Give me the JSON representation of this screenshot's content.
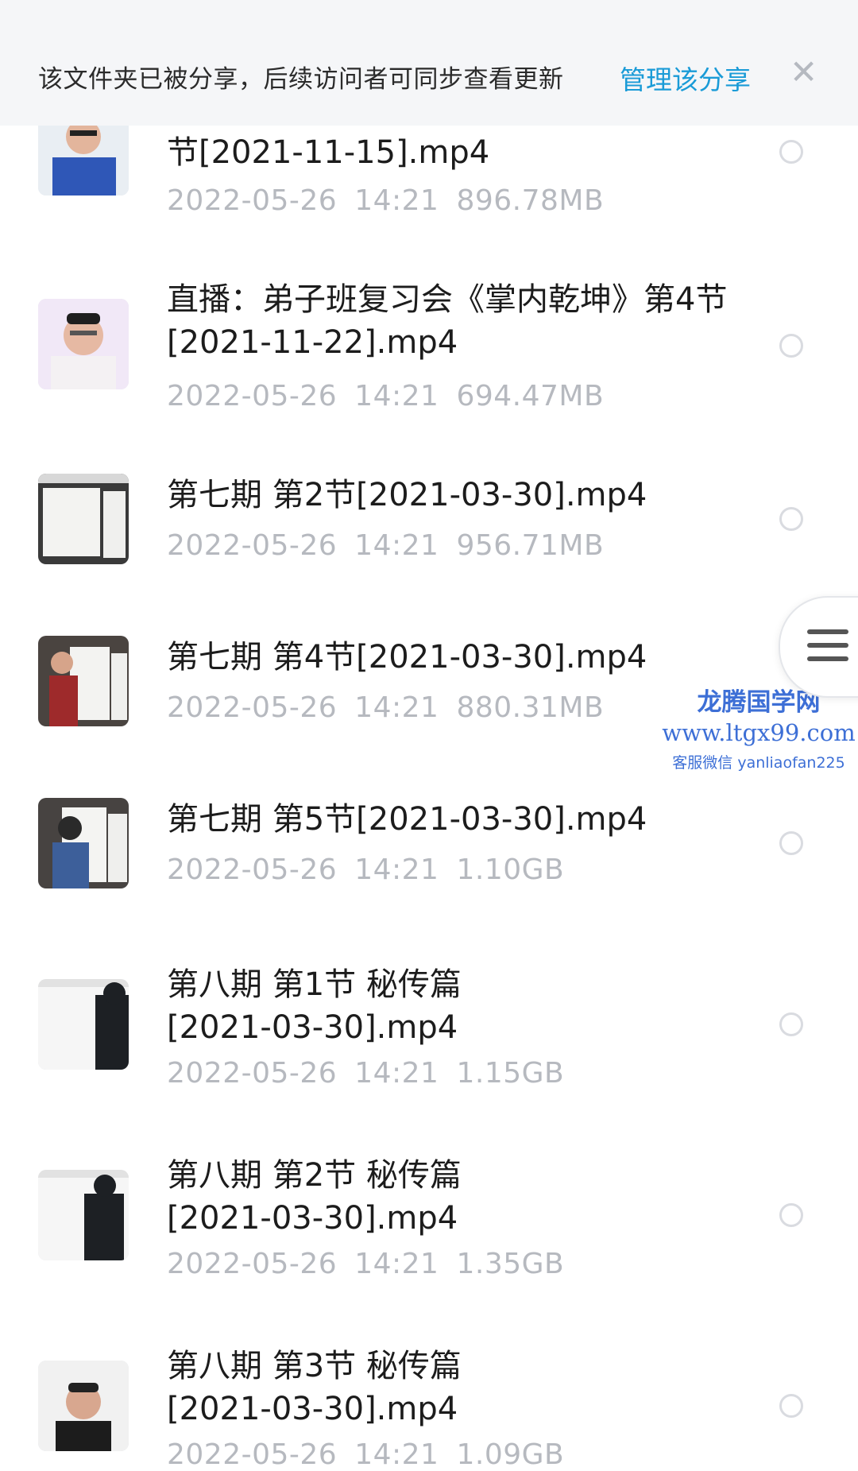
{
  "banner": {
    "message": "该文件夹已被分享，后续访问者可同步查看更新",
    "manage_label": "管理该分享",
    "close_icon": "close-icon",
    "close_glyph": "✕"
  },
  "files": [
    {
      "name": "节[2021-11-15].mp4",
      "date": "2022-05-26",
      "time": "14:21",
      "size": "896.78MB",
      "thumb": "portrait"
    },
    {
      "name": "直播：弟子班复习会《掌内乾坤》第4节[2021-11-22].mp4",
      "date": "2022-05-26",
      "time": "14:21",
      "size": "694.47MB",
      "thumb": "portrait"
    },
    {
      "name": "第七期  第2节[2021-03-30].mp4",
      "date": "2022-05-26",
      "time": "14:21",
      "size": "956.71MB",
      "thumb": "whiteboard"
    },
    {
      "name": "第七期  第4节[2021-03-30].mp4",
      "date": "2022-05-26",
      "time": "14:21",
      "size": "880.31MB",
      "thumb": "teacher-red"
    },
    {
      "name": "第七期  第5节[2021-03-30].mp4",
      "date": "2022-05-26",
      "time": "14:21",
      "size": "1.10GB",
      "thumb": "teacher-blue"
    },
    {
      "name": "第八期  第1节  秘传篇 [2021-03-30].mp4",
      "date": "2022-05-26",
      "time": "14:21",
      "size": "1.15GB",
      "thumb": "teacher-back"
    },
    {
      "name": "第八期  第2节  秘传篇 [2021-03-30].mp4",
      "date": "2022-05-26",
      "time": "14:21",
      "size": "1.35GB",
      "thumb": "teacher-back"
    },
    {
      "name": "第八期  第3节  秘传篇 [2021-03-30].mp4",
      "date": "2022-05-26",
      "time": "14:21",
      "size": "1.09GB",
      "thumb": "portrait"
    }
  ],
  "float_menu": {
    "icon": "menu-icon"
  },
  "watermark": {
    "title": "龙腾国学网",
    "url": "www.ltgx99.com",
    "contact": "客服微信 yanliaofan225"
  },
  "colors": {
    "accent": "#1a9bd7",
    "meta_text": "#b6b9bf",
    "banner_bg": "#f5f6f8",
    "watermark": "#3d6fd6"
  }
}
